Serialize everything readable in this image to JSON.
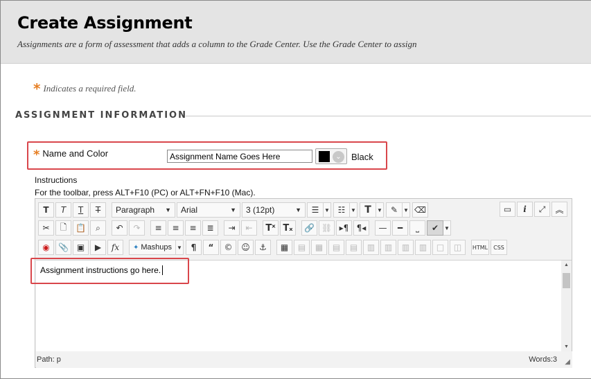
{
  "header": {
    "title": "Create Assignment",
    "description": "Assignments are a form of assessment that adds a column to the Grade Center. Use the Grade Center to assign"
  },
  "required_note": {
    "star": "*",
    "text": "Indicates a required field."
  },
  "section_title": "ASSIGNMENT INFORMATION",
  "name_field": {
    "star": "*",
    "label": "Name and Color",
    "value": "Assignment Name Goes Here",
    "color_value": "#000000",
    "color_name": "Black"
  },
  "instructions": {
    "label": "Instructions",
    "hint": "For the toolbar, press ALT+F10 (PC) or ALT+FN+F10 (Mac)."
  },
  "toolbar": {
    "paragraph": "Paragraph",
    "font": "Arial",
    "size": "3 (12pt)",
    "mashups": "Mashups",
    "html": "HTML",
    "css": "CSS"
  },
  "editor": {
    "content": "Assignment instructions go here.",
    "path_label": "Path: p",
    "word_count": "Words:3"
  },
  "colors": {
    "highlight": "#d9464b",
    "required_star": "#e67e22",
    "header_bg": "#e4e4e4"
  }
}
